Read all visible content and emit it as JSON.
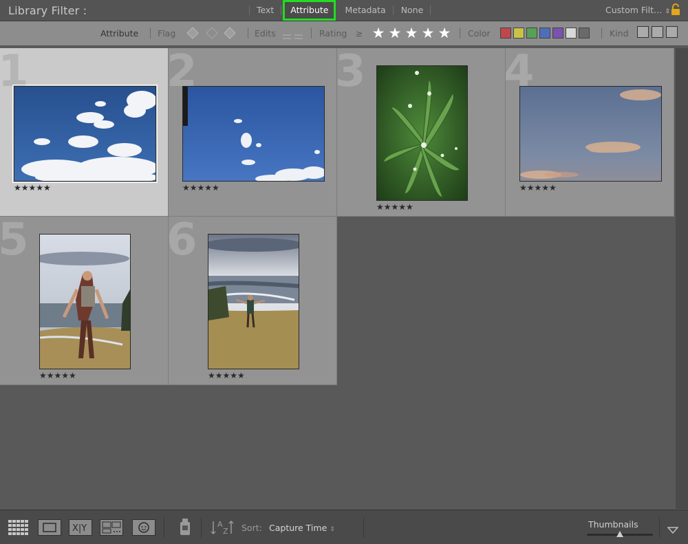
{
  "filter_bar": {
    "title": "Library Filter :",
    "tabs": [
      "Text",
      "Attribute",
      "Metadata",
      "None"
    ],
    "active_tab": "Attribute",
    "preset": "Custom Filt…",
    "lock_icon": "lock-icon"
  },
  "attribute_bar": {
    "attribute_label": "Attribute",
    "flag_label": "Flag",
    "edits_label": "Edits",
    "rating_label": "Rating",
    "rating_op": "≥",
    "rating_stars": "★★★★★",
    "rating_value": 5,
    "color_label": "Color",
    "color_swatches": [
      "#c0484c",
      "#c8c24a",
      "#58a058",
      "#4e6fb8",
      "#7a52b0",
      "#d8d8d8",
      "#6a6a6a"
    ],
    "kind_label": "Kind"
  },
  "photos": [
    {
      "number": "1",
      "stars": "★★★★★",
      "rating": 5,
      "subject": "blue sky with clouds",
      "selected": true
    },
    {
      "number": "2",
      "stars": "★★★★★",
      "rating": 5,
      "subject": "blue sky with small clouds",
      "selected": false
    },
    {
      "number": "3",
      "stars": "★★★★★",
      "rating": 5,
      "subject": "green plant with water droplets",
      "selected": false
    },
    {
      "number": "4",
      "stars": "★★★★★",
      "rating": 5,
      "subject": "sunset sky",
      "selected": false
    },
    {
      "number": "5",
      "stars": "★★★★★",
      "rating": 5,
      "subject": "woman hiking on hillside",
      "selected": false
    },
    {
      "number": "6",
      "stars": "★★★★★",
      "rating": 5,
      "subject": "person with arms out above river valley",
      "selected": false
    }
  ],
  "toolbar": {
    "view_buttons": [
      "grid-view",
      "loupe-view",
      "compare-view",
      "survey-view",
      "people-view"
    ],
    "compare_text": "X|Y",
    "sort_label": "Sort:",
    "sort_value": "Capture Time",
    "thumbnails_label": "Thumbnails",
    "thumbnail_size": 0.5
  }
}
